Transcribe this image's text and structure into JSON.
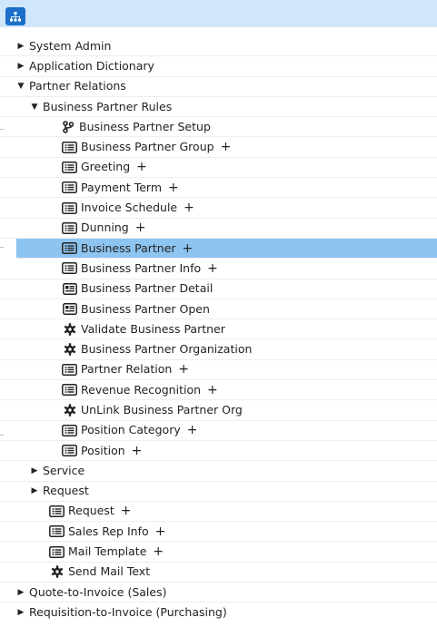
{
  "tree": {
    "system_admin": "System Admin",
    "application_dictionary": "Application Dictionary",
    "partner_relations": "Partner Relations",
    "business_partner_rules": "Business Partner Rules",
    "bp_setup": "Business Partner Setup",
    "bp_group": "Business Partner Group",
    "greeting": "Greeting",
    "payment_term": "Payment Term",
    "invoice_schedule": "Invoice Schedule",
    "dunning": "Dunning",
    "business_partner": "Business Partner",
    "bp_info": "Business Partner Info",
    "bp_detail": "Business Partner Detail",
    "bp_open": "Business Partner Open",
    "validate_bp": "Validate Business Partner",
    "bp_organization": "Business Partner Organization",
    "partner_relation": "Partner Relation",
    "revenue_recognition": "Revenue Recognition",
    "unlink_bp_org": "UnLink Business Partner Org",
    "position_category": "Position Category",
    "position": "Position",
    "service": "Service",
    "request_folder": "Request",
    "request": "Request",
    "sales_rep_info": "Sales Rep Info",
    "mail_template": "Mail Template",
    "send_mail_text": "Send Mail Text",
    "quote_to_invoice": "Quote-to-Invoice (Sales)",
    "requisition_to_invoice": "Requisition-to-Invoice (Purchasing)",
    "plus": "+"
  },
  "icons": {
    "window": "window-icon",
    "report": "report-icon",
    "process": "gear-icon",
    "workflow": "workflow-icon",
    "caret_right": "caret-right-icon",
    "caret_down": "caret-down-icon"
  },
  "colors": {
    "selected": "#8ec4f0",
    "topbar": "#cfe6fb",
    "accent": "#1c6fc8"
  }
}
